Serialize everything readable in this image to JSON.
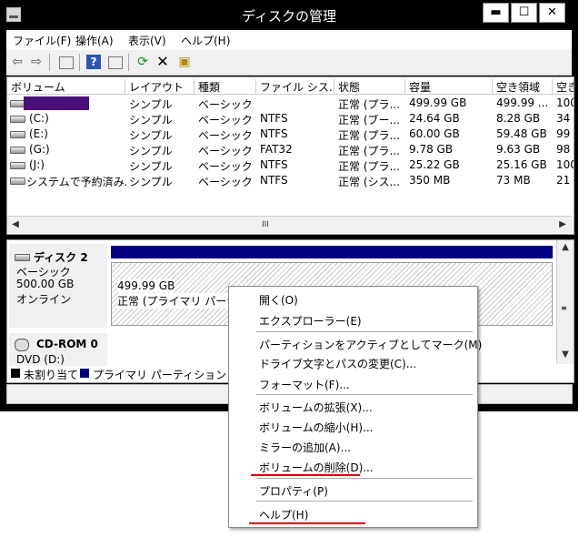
{
  "window": {
    "title": "ディスクの管理",
    "controls": {
      "minimize": "▬",
      "maximize": "☐",
      "close": "✕"
    }
  },
  "menubar": [
    "ファイル(F)",
    "操作(A)",
    "表示(V)",
    "ヘルプ(H)"
  ],
  "toolbar": {
    "icons": [
      "back-arrow-icon",
      "forward-arrow-icon",
      "console-icon",
      "help-icon",
      "properties-icon",
      "refresh-icon",
      "delete-x-icon",
      "wizard-icon"
    ],
    "help_glyph": "?",
    "delete_glyph": "✕"
  },
  "volume_table": {
    "columns": [
      "ボリューム",
      "レイアウト",
      "種類",
      "ファイル シス...",
      "状態",
      "容量",
      "空き領域",
      "空き"
    ],
    "rows": [
      {
        "name": "",
        "layout": "シンプル",
        "type": "ベーシック",
        "fs": "",
        "status": "正常 (プラ...",
        "capacity": "499.99 GB",
        "free": "499.99 ...",
        "pct": "100"
      },
      {
        "name": "(C:)",
        "layout": "シンプル",
        "type": "ベーシック",
        "fs": "NTFS",
        "status": "正常 (ブー...",
        "capacity": "24.64 GB",
        "free": "8.28 GB",
        "pct": "34"
      },
      {
        "name": "(E:)",
        "layout": "シンプル",
        "type": "ベーシック",
        "fs": "NTFS",
        "status": "正常 (プラ...",
        "capacity": "60.00 GB",
        "free": "59.48 GB",
        "pct": "99"
      },
      {
        "name": "(G:)",
        "layout": "シンプル",
        "type": "ベーシック",
        "fs": "FAT32",
        "status": "正常 (プラ...",
        "capacity": "9.78 GB",
        "free": "9.63 GB",
        "pct": "98"
      },
      {
        "name": "(J:)",
        "layout": "シンプル",
        "type": "ベーシック",
        "fs": "NTFS",
        "status": "正常 (プラ...",
        "capacity": "25.22 GB",
        "free": "25.16 GB",
        "pct": "100"
      },
      {
        "name": "システムで予約済み...",
        "layout": "シンプル",
        "type": "ベーシック",
        "fs": "NTFS",
        "status": "正常 (シス...",
        "capacity": "350 MB",
        "free": "73 MB",
        "pct": "21"
      }
    ],
    "scroll_thumb": "III",
    "scroll_left": "◀",
    "scroll_right": "▶"
  },
  "disk_view": {
    "disk2": {
      "name": "ディスク 2",
      "type": "ベーシック",
      "size": "500.00 GB",
      "state": "オンライン"
    },
    "partition": {
      "size": "499.99 GB",
      "status": "正常 (プライマリ パーティショ"
    },
    "cdrom": {
      "name": "CD-ROM 0",
      "drive": "DVD (D:)"
    },
    "scroll_up": "▲",
    "scroll_down": "▼",
    "legend": [
      {
        "label": "未割り当て",
        "color": "#000000"
      },
      {
        "label": "プライマリ パーティション",
        "color": "#000080"
      }
    ]
  },
  "context_menu": {
    "items": [
      "開く(O)",
      "エクスプローラー(E)",
      "パーティションをアクティブとしてマーク(M)",
      "ドライブ文字とパスの変更(C)...",
      "フォーマット(F)...",
      "ボリュームの拡張(X)...",
      "ボリュームの縮小(H)...",
      "ミラーの追加(A)...",
      "ボリュームの削除(D)...",
      "プロパティ(P)",
      "ヘルプ(H)"
    ]
  },
  "colors": {
    "primary_partition": "#000080",
    "selection": "#4b0f7a",
    "highlight_underline": "#e00000"
  }
}
